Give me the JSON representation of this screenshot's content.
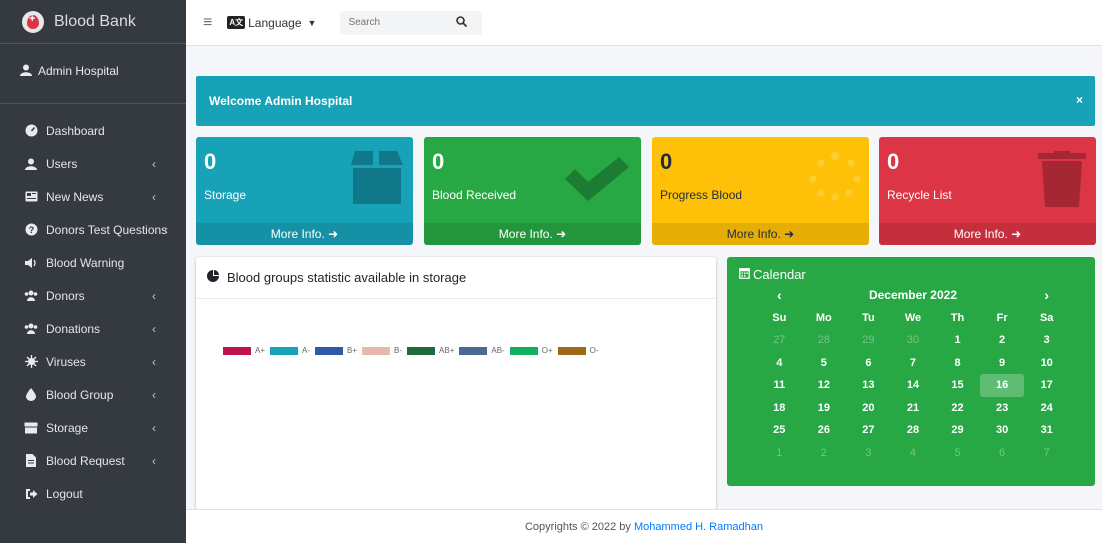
{
  "brand": {
    "name": "Blood Bank"
  },
  "user": {
    "name": "Admin Hospital"
  },
  "sidebar": {
    "items": [
      {
        "label": "Dashboard",
        "icon": "tachometer-icon",
        "has_submenu": false
      },
      {
        "label": "Users",
        "icon": "user-icon",
        "has_submenu": true
      },
      {
        "label": "New News",
        "icon": "newspaper-icon",
        "has_submenu": true
      },
      {
        "label": "Donors Test Questions",
        "icon": "question-circle-icon",
        "has_submenu": true
      },
      {
        "label": "Blood Warning",
        "icon": "volume-icon",
        "has_submenu": false
      },
      {
        "label": "Donors",
        "icon": "users-icon",
        "has_submenu": true
      },
      {
        "label": "Donations",
        "icon": "users-icon",
        "has_submenu": true
      },
      {
        "label": "Viruses",
        "icon": "virus-icon",
        "has_submenu": true
      },
      {
        "label": "Blood Group",
        "icon": "tint-icon",
        "has_submenu": true
      },
      {
        "label": "Storage",
        "icon": "box-icon",
        "has_submenu": true
      },
      {
        "label": "Blood Request",
        "icon": "file-icon",
        "has_submenu": true
      },
      {
        "label": "Logout",
        "icon": "sign-out-icon",
        "has_submenu": false
      }
    ]
  },
  "topbar": {
    "language_label": "Language",
    "search_placeholder": "Search"
  },
  "welcome": {
    "text": "Welcome Admin Hospital",
    "close": "×"
  },
  "boxes": [
    {
      "value": "0",
      "label": "Storage",
      "more": "More Info.",
      "color": "#17a2b8",
      "icon": "box-icon"
    },
    {
      "value": "0",
      "label": "Blood Received",
      "more": "More Info.",
      "color": "#28a745",
      "icon": "check-icon"
    },
    {
      "value": "0",
      "label": "Progress Blood",
      "more": "More Info.",
      "color": "#ffc107",
      "icon": "spinner-icon"
    },
    {
      "value": "0",
      "label": "Recycle List",
      "more": "More Info.",
      "color": "#dc3545",
      "icon": "trash-icon"
    }
  ],
  "chart_card": {
    "title": "Blood groups statistic available in storage",
    "legend": [
      {
        "label": "A+",
        "color": "#c0134a"
      },
      {
        "label": "A-",
        "color": "#17a2b8"
      },
      {
        "label": "B+",
        "color": "#2e5aa8"
      },
      {
        "label": "B-",
        "color": "#e8b8b0"
      },
      {
        "label": "AB+",
        "color": "#1e6b3c"
      },
      {
        "label": "AB-",
        "color": "#4a6a90"
      },
      {
        "label": "O+",
        "color": "#10b060"
      },
      {
        "label": "O-",
        "color": "#9a6a1a"
      }
    ]
  },
  "calendar": {
    "title": "Calendar",
    "month": "December 2022",
    "prev": "‹",
    "next": "›",
    "weekdays": [
      "Su",
      "Mo",
      "Tu",
      "We",
      "Th",
      "Fr",
      "Sa"
    ],
    "weeks": [
      [
        "27",
        "28",
        "29",
        "30",
        "1",
        "2",
        "3"
      ],
      [
        "4",
        "5",
        "6",
        "7",
        "8",
        "9",
        "10"
      ],
      [
        "11",
        "12",
        "13",
        "14",
        "15",
        "16",
        "17"
      ],
      [
        "18",
        "19",
        "20",
        "21",
        "22",
        "23",
        "24"
      ],
      [
        "25",
        "26",
        "27",
        "28",
        "29",
        "30",
        "31"
      ],
      [
        "1",
        "2",
        "3",
        "4",
        "5",
        "6",
        "7"
      ]
    ],
    "today": "16"
  },
  "footer": {
    "text": "Copyrights © 2022 by ",
    "author": "Mohammed H. Ramadhan"
  }
}
